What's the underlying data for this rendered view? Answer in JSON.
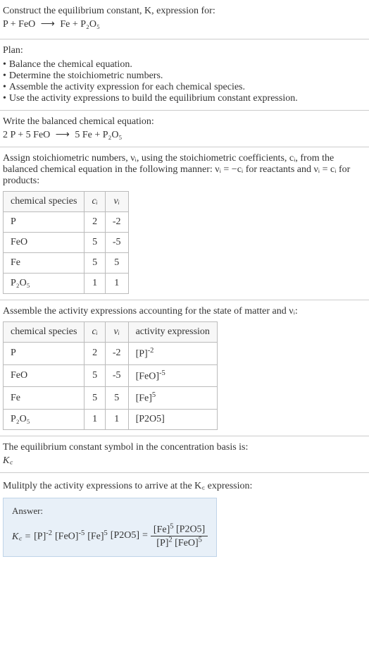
{
  "intro": {
    "text": "Construct the equilibrium constant, K, expression for:",
    "equation_lhs": "P + FeO",
    "arrow": "⟶",
    "equation_rhs": "Fe + P₂O₅"
  },
  "plan": {
    "heading": "Plan:",
    "bullets": [
      "Balance the chemical equation.",
      "Determine the stoichiometric numbers.",
      "Assemble the activity expression for each chemical species.",
      "Use the activity expressions to build the equilibrium constant expression."
    ]
  },
  "balanced": {
    "heading": "Write the balanced chemical equation:",
    "equation_lhs": "2 P + 5 FeO",
    "arrow": "⟶",
    "equation_rhs": "5 Fe + P₂O₅"
  },
  "stoich": {
    "text_part1": "Assign stoichiometric numbers, νᵢ, using the stoichiometric coefficients, cᵢ, from the balanced chemical equation in the following manner: νᵢ = −cᵢ for reactants and νᵢ = cᵢ for products:",
    "headers": [
      "chemical species",
      "cᵢ",
      "νᵢ"
    ],
    "rows": [
      {
        "species": "P",
        "ci": "2",
        "vi": "-2"
      },
      {
        "species": "FeO",
        "ci": "5",
        "vi": "-5"
      },
      {
        "species": "Fe",
        "ci": "5",
        "vi": "5"
      },
      {
        "species": "P₂O₅",
        "ci": "1",
        "vi": "1"
      }
    ]
  },
  "activity": {
    "heading": "Assemble the activity expressions accounting for the state of matter and νᵢ:",
    "headers": [
      "chemical species",
      "cᵢ",
      "νᵢ",
      "activity expression"
    ],
    "rows": [
      {
        "species": "P",
        "ci": "2",
        "vi": "-2",
        "expr_base": "[P]",
        "expr_exp": "-2"
      },
      {
        "species": "FeO",
        "ci": "5",
        "vi": "-5",
        "expr_base": "[FeO]",
        "expr_exp": "-5"
      },
      {
        "species": "Fe",
        "ci": "5",
        "vi": "5",
        "expr_base": "[Fe]",
        "expr_exp": "5"
      },
      {
        "species": "P₂O₅",
        "ci": "1",
        "vi": "1",
        "expr_base": "[P2O5]",
        "expr_exp": ""
      }
    ]
  },
  "symbol": {
    "heading": "The equilibrium constant symbol in the concentration basis is:",
    "value": "K꜀"
  },
  "multiply": {
    "heading": "Mulitply the activity expressions to arrive at the K꜀ expression:"
  },
  "answer": {
    "label": "Answer:",
    "kc": "K꜀ =",
    "term1_base": "[P]",
    "term1_exp": "-2",
    "term2_base": "[FeO]",
    "term2_exp": "-5",
    "term3_base": "[Fe]",
    "term3_exp": "5",
    "term4_base": "[P2O5]",
    "equals": "=",
    "num1_base": "[Fe]",
    "num1_exp": "5",
    "num2_base": "[P2O5]",
    "den1_base": "[P]",
    "den1_exp": "2",
    "den2_base": "[FeO]",
    "den2_exp": "5"
  }
}
